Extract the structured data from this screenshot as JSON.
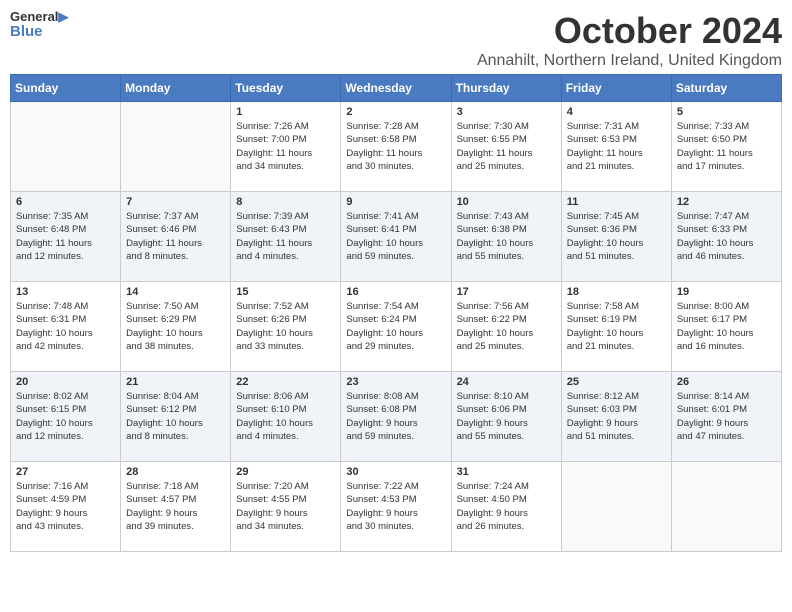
{
  "header": {
    "logo_general": "General",
    "logo_blue": "Blue",
    "month": "October 2024",
    "location": "Annahilt, Northern Ireland, United Kingdom"
  },
  "days_of_week": [
    "Sunday",
    "Monday",
    "Tuesday",
    "Wednesday",
    "Thursday",
    "Friday",
    "Saturday"
  ],
  "weeks": [
    [
      {
        "day": "",
        "info": ""
      },
      {
        "day": "",
        "info": ""
      },
      {
        "day": "1",
        "info": "Sunrise: 7:26 AM\nSunset: 7:00 PM\nDaylight: 11 hours\nand 34 minutes."
      },
      {
        "day": "2",
        "info": "Sunrise: 7:28 AM\nSunset: 6:58 PM\nDaylight: 11 hours\nand 30 minutes."
      },
      {
        "day": "3",
        "info": "Sunrise: 7:30 AM\nSunset: 6:55 PM\nDaylight: 11 hours\nand 25 minutes."
      },
      {
        "day": "4",
        "info": "Sunrise: 7:31 AM\nSunset: 6:53 PM\nDaylight: 11 hours\nand 21 minutes."
      },
      {
        "day": "5",
        "info": "Sunrise: 7:33 AM\nSunset: 6:50 PM\nDaylight: 11 hours\nand 17 minutes."
      }
    ],
    [
      {
        "day": "6",
        "info": "Sunrise: 7:35 AM\nSunset: 6:48 PM\nDaylight: 11 hours\nand 12 minutes."
      },
      {
        "day": "7",
        "info": "Sunrise: 7:37 AM\nSunset: 6:46 PM\nDaylight: 11 hours\nand 8 minutes."
      },
      {
        "day": "8",
        "info": "Sunrise: 7:39 AM\nSunset: 6:43 PM\nDaylight: 11 hours\nand 4 minutes."
      },
      {
        "day": "9",
        "info": "Sunrise: 7:41 AM\nSunset: 6:41 PM\nDaylight: 10 hours\nand 59 minutes."
      },
      {
        "day": "10",
        "info": "Sunrise: 7:43 AM\nSunset: 6:38 PM\nDaylight: 10 hours\nand 55 minutes."
      },
      {
        "day": "11",
        "info": "Sunrise: 7:45 AM\nSunset: 6:36 PM\nDaylight: 10 hours\nand 51 minutes."
      },
      {
        "day": "12",
        "info": "Sunrise: 7:47 AM\nSunset: 6:33 PM\nDaylight: 10 hours\nand 46 minutes."
      }
    ],
    [
      {
        "day": "13",
        "info": "Sunrise: 7:48 AM\nSunset: 6:31 PM\nDaylight: 10 hours\nand 42 minutes."
      },
      {
        "day": "14",
        "info": "Sunrise: 7:50 AM\nSunset: 6:29 PM\nDaylight: 10 hours\nand 38 minutes."
      },
      {
        "day": "15",
        "info": "Sunrise: 7:52 AM\nSunset: 6:26 PM\nDaylight: 10 hours\nand 33 minutes."
      },
      {
        "day": "16",
        "info": "Sunrise: 7:54 AM\nSunset: 6:24 PM\nDaylight: 10 hours\nand 29 minutes."
      },
      {
        "day": "17",
        "info": "Sunrise: 7:56 AM\nSunset: 6:22 PM\nDaylight: 10 hours\nand 25 minutes."
      },
      {
        "day": "18",
        "info": "Sunrise: 7:58 AM\nSunset: 6:19 PM\nDaylight: 10 hours\nand 21 minutes."
      },
      {
        "day": "19",
        "info": "Sunrise: 8:00 AM\nSunset: 6:17 PM\nDaylight: 10 hours\nand 16 minutes."
      }
    ],
    [
      {
        "day": "20",
        "info": "Sunrise: 8:02 AM\nSunset: 6:15 PM\nDaylight: 10 hours\nand 12 minutes."
      },
      {
        "day": "21",
        "info": "Sunrise: 8:04 AM\nSunset: 6:12 PM\nDaylight: 10 hours\nand 8 minutes."
      },
      {
        "day": "22",
        "info": "Sunrise: 8:06 AM\nSunset: 6:10 PM\nDaylight: 10 hours\nand 4 minutes."
      },
      {
        "day": "23",
        "info": "Sunrise: 8:08 AM\nSunset: 6:08 PM\nDaylight: 9 hours\nand 59 minutes."
      },
      {
        "day": "24",
        "info": "Sunrise: 8:10 AM\nSunset: 6:06 PM\nDaylight: 9 hours\nand 55 minutes."
      },
      {
        "day": "25",
        "info": "Sunrise: 8:12 AM\nSunset: 6:03 PM\nDaylight: 9 hours\nand 51 minutes."
      },
      {
        "day": "26",
        "info": "Sunrise: 8:14 AM\nSunset: 6:01 PM\nDaylight: 9 hours\nand 47 minutes."
      }
    ],
    [
      {
        "day": "27",
        "info": "Sunrise: 7:16 AM\nSunset: 4:59 PM\nDaylight: 9 hours\nand 43 minutes."
      },
      {
        "day": "28",
        "info": "Sunrise: 7:18 AM\nSunset: 4:57 PM\nDaylight: 9 hours\nand 39 minutes."
      },
      {
        "day": "29",
        "info": "Sunrise: 7:20 AM\nSunset: 4:55 PM\nDaylight: 9 hours\nand 34 minutes."
      },
      {
        "day": "30",
        "info": "Sunrise: 7:22 AM\nSunset: 4:53 PM\nDaylight: 9 hours\nand 30 minutes."
      },
      {
        "day": "31",
        "info": "Sunrise: 7:24 AM\nSunset: 4:50 PM\nDaylight: 9 hours\nand 26 minutes."
      },
      {
        "day": "",
        "info": ""
      },
      {
        "day": "",
        "info": ""
      }
    ]
  ]
}
